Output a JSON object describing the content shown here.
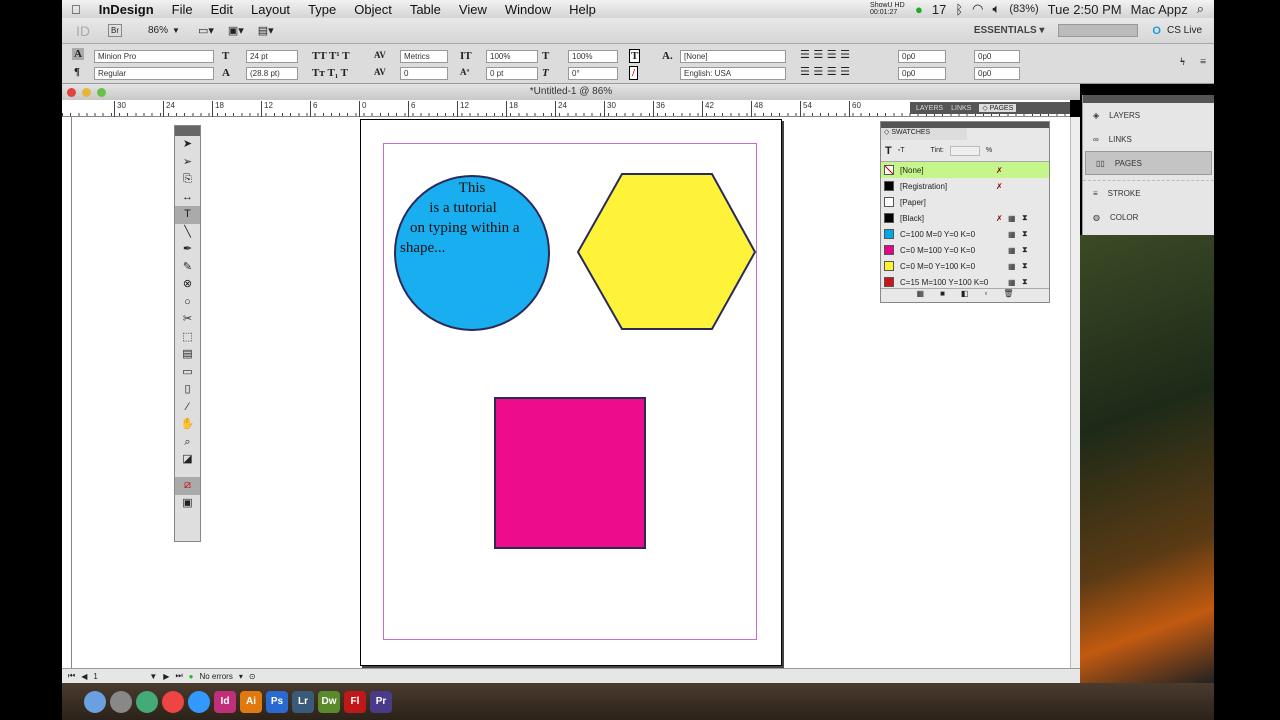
{
  "menubar": {
    "app": "InDesign",
    "items": [
      "File",
      "Edit",
      "Layout",
      "Type",
      "Object",
      "Table",
      "View",
      "Window",
      "Help"
    ],
    "battery": "(83%)",
    "clock": "Tue 2:50 PM",
    "user": "Mac Appz",
    "badge": "17",
    "recorder": "ShowU HD 00:01:27"
  },
  "appbar": {
    "zoom": "86%",
    "workspace": "ESSENTIALS ▾",
    "search_placeholder": "",
    "cslive": "CS Live"
  },
  "control": {
    "font": "Minion Pro",
    "style": "Regular",
    "size": "24 pt",
    "leading": "(28.8 pt)",
    "kerning": "Metrics",
    "tracking": "0",
    "vscale": "100%",
    "hscale": "100%",
    "baseline": "0 pt",
    "skew": "0°",
    "char_style": "[None]",
    "language": "English: USA",
    "indent_left": "0p0",
    "indent_right": "0p0",
    "indent_first": "0p0",
    "indent_last": "0p0"
  },
  "document": {
    "title": "*Untitled-1 @ 86%",
    "ruler_ticks": [
      "30",
      "24",
      "18",
      "12",
      "6",
      "0",
      "6",
      "12",
      "18",
      "24",
      "30",
      "36",
      "42",
      "48",
      "54",
      "60"
    ],
    "text_lines": [
      "This",
      "is a tutorial",
      "on typing within a",
      "shape..."
    ]
  },
  "status": {
    "page": "1",
    "preflight": "No errors"
  },
  "panel_tabs": [
    "LAYERS",
    "LINKS",
    "◇ PAGES"
  ],
  "swatches": {
    "title": "◇ SWATCHES",
    "tint_label": "Tint:",
    "tint_unit": "%",
    "items": [
      {
        "name": "[None]",
        "color": "#ffffff"
      },
      {
        "name": "[Registration]",
        "color": "#000000"
      },
      {
        "name": "[Paper]",
        "color": "#ffffff"
      },
      {
        "name": "[Black]",
        "color": "#000000"
      },
      {
        "name": "C=100 M=0 Y=0 K=0",
        "color": "#00a8e8"
      },
      {
        "name": "C=0 M=100 Y=0 K=0",
        "color": "#e8008a"
      },
      {
        "name": "C=0 M=0 Y=100 K=0",
        "color": "#fff22e"
      },
      {
        "name": "C=15 M=100 Y=100 K=0",
        "color": "#d0121b"
      }
    ]
  },
  "right_panel": [
    "LAYERS",
    "LINKS",
    "PAGES",
    "STROKE",
    "COLOR"
  ],
  "shapes": {
    "circle": "#19aeef",
    "hexagon": "#fff33a",
    "square": "#ec0c8c"
  },
  "dock": [
    "Finder",
    "Launchpad",
    "Preview",
    "Chrome",
    "App Store",
    "Id",
    "Ai",
    "Ps",
    "Lr",
    "Dw",
    "Fl",
    "Pr"
  ]
}
